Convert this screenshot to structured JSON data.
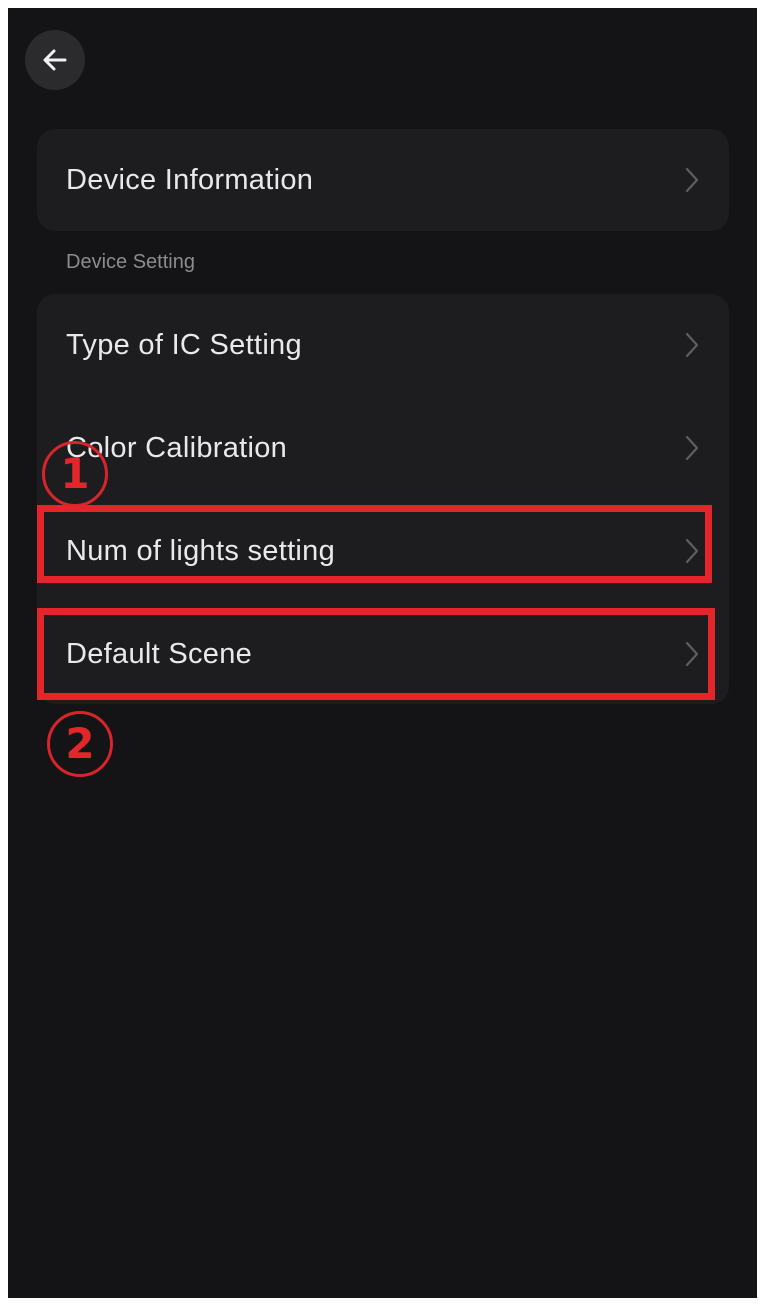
{
  "header": {
    "back_icon": "arrow-left-icon"
  },
  "device_information": {
    "label": "Device Information",
    "chevron_icon": "chevron-right-icon"
  },
  "device_setting": {
    "section_label": "Device Setting",
    "items": [
      {
        "label": "Type of IC Setting",
        "chevron_icon": "chevron-right-icon"
      },
      {
        "label": "Color Calibration",
        "chevron_icon": "chevron-right-icon"
      },
      {
        "label": "Num of lights setting",
        "chevron_icon": "chevron-right-icon"
      },
      {
        "label": "Default Scene",
        "chevron_icon": "chevron-right-icon"
      }
    ]
  },
  "annotations": {
    "marker_1": "1",
    "marker_2": "2",
    "highlight_color": "#e3262b"
  },
  "colors": {
    "background": "#141416",
    "card": "#1d1d20",
    "text": "#e9e9ec",
    "secondary_text": "#8b8b90"
  }
}
